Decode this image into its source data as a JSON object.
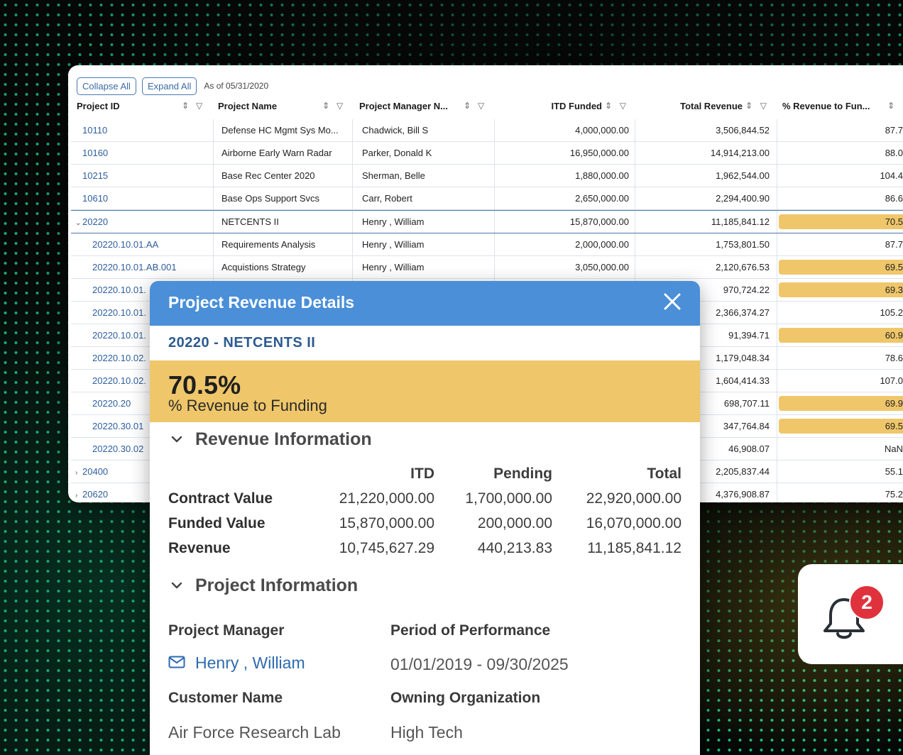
{
  "toolbar": {
    "collapse_label": "Collapse All",
    "expand_label": "Expand All",
    "as_of": "As of 05/31/2020"
  },
  "columns": [
    "Project ID",
    "Project Name",
    "Project Manager N...",
    "ITD Funded",
    "Total Revenue",
    "% Revenue to Fun..."
  ],
  "rows": [
    {
      "id": "10110",
      "name": "Defense HC Mgmt Sys Mo...",
      "mgr": "Chadwick, Bill S",
      "itd": "4,000,000.00",
      "rev": "3,506,844.52",
      "pct": "87.7",
      "level": 0,
      "chev": "",
      "hl": false
    },
    {
      "id": "10160",
      "name": "Airborne Early Warn Radar",
      "mgr": "Parker, Donald K",
      "itd": "16,950,000.00",
      "rev": "14,914,213.00",
      "pct": "88.0",
      "level": 0,
      "chev": "",
      "hl": false
    },
    {
      "id": "10215",
      "name": "Base Rec Center 2020",
      "mgr": "Sherman, Belle",
      "itd": "1,880,000.00",
      "rev": "1,962,544.00",
      "pct": "104.4",
      "level": 0,
      "chev": "",
      "hl": false
    },
    {
      "id": "10610",
      "name": "Base Ops Support Svcs",
      "mgr": "Carr, Robert",
      "itd": "2,650,000.00",
      "rev": "2,294,400.90",
      "pct": "86.6",
      "level": 0,
      "chev": "",
      "hl": false
    },
    {
      "id": "20220",
      "name": "NETCENTS II",
      "mgr": "Henry , William",
      "itd": "15,870,000.00",
      "rev": "11,185,841.12",
      "pct": "70.5",
      "level": 0,
      "chev": "⌄",
      "hl": true,
      "sel": true
    },
    {
      "id": "20220.10.01.AA",
      "name": "Requirements Analysis",
      "mgr": "Henry , William",
      "itd": "2,000,000.00",
      "rev": "1,753,801.50",
      "pct": "87.7",
      "level": 1,
      "chev": "",
      "hl": false
    },
    {
      "id": "20220.10.01.AB.001",
      "name": "Acquistions Strategy",
      "mgr": "Henry , William",
      "itd": "3,050,000.00",
      "rev": "2,120,676.53",
      "pct": "69.5",
      "level": 1,
      "chev": "",
      "hl": true
    },
    {
      "id": "20220.10.01.",
      "name": "",
      "mgr": "",
      "itd": "",
      "rev": "970,724.22",
      "pct": "69.3",
      "level": 1,
      "chev": "",
      "hl": true
    },
    {
      "id": "20220.10.01.",
      "name": "",
      "mgr": "",
      "itd": "",
      "rev": "2,366,374.27",
      "pct": "105.2",
      "level": 1,
      "chev": "",
      "hl": false
    },
    {
      "id": "20220.10.01.",
      "name": "",
      "mgr": "",
      "itd": "",
      "rev": "91,394.71",
      "pct": "60.9",
      "level": 1,
      "chev": "",
      "hl": true
    },
    {
      "id": "20220.10.02.",
      "name": "",
      "mgr": "",
      "itd": "",
      "rev": "1,179,048.34",
      "pct": "78.6",
      "level": 1,
      "chev": "",
      "hl": false
    },
    {
      "id": "20220.10.02.",
      "name": "",
      "mgr": "",
      "itd": "",
      "rev": "1,604,414.33",
      "pct": "107.0",
      "level": 1,
      "chev": "",
      "hl": false
    },
    {
      "id": "20220.20",
      "name": "",
      "mgr": "",
      "itd": "",
      "rev": "698,707.11",
      "pct": "69.9",
      "level": 1,
      "chev": "",
      "hl": true
    },
    {
      "id": "20220.30.01",
      "name": "",
      "mgr": "",
      "itd": "",
      "rev": "347,764.84",
      "pct": "69.5",
      "level": 1,
      "chev": "",
      "hl": true
    },
    {
      "id": "20220.30.02",
      "name": "",
      "mgr": "",
      "itd": "",
      "rev": "46,908.07",
      "pct": "NaN",
      "level": 1,
      "chev": "",
      "hl": false
    },
    {
      "id": "20400",
      "name": "",
      "mgr": "",
      "itd": "",
      "rev": "2,205,837.44",
      "pct": "55.1",
      "level": 0,
      "chev": "›",
      "hl": false
    },
    {
      "id": "20620",
      "name": "",
      "mgr": "",
      "itd": "",
      "rev": "4,376,908.87",
      "pct": "75.2",
      "level": 0,
      "chev": "›",
      "hl": false
    }
  ],
  "modal": {
    "title": "Project Revenue Details",
    "subtitle": "20220 - NETCENTS II",
    "percent": "70.5%",
    "percent_label": "% Revenue to Funding",
    "revenue_section": "Revenue Information",
    "rev_headers": {
      "itd": "ITD",
      "pending": "Pending",
      "total": "Total"
    },
    "rev_rows": [
      {
        "label": "Contract Value",
        "itd": "21,220,000.00",
        "pending": "1,700,000.00",
        "total": "22,920,000.00"
      },
      {
        "label": "Funded Value",
        "itd": "15,870,000.00",
        "pending": "200,000.00",
        "total": "16,070,000.00"
      },
      {
        "label": "Revenue",
        "itd": "10,745,627.29",
        "pending": "440,213.83",
        "total": "11,185,841.12"
      }
    ],
    "project_section": "Project Information",
    "pm_label": "Project Manager",
    "pm_value": "Henry , William",
    "pop_label": "Period of Performance",
    "pop_value": "01/01/2019 - 09/30/2025",
    "customer_label": "Customer Name",
    "customer_value": "Air Force Research Lab",
    "org_label": "Owning Organization",
    "org_value": "High Tech"
  },
  "notification": {
    "count": "2"
  },
  "colors": {
    "accent": "#4a8fd8",
    "highlight": "#efc76a",
    "link": "#2e5e9e",
    "badge": "#e0323d"
  }
}
